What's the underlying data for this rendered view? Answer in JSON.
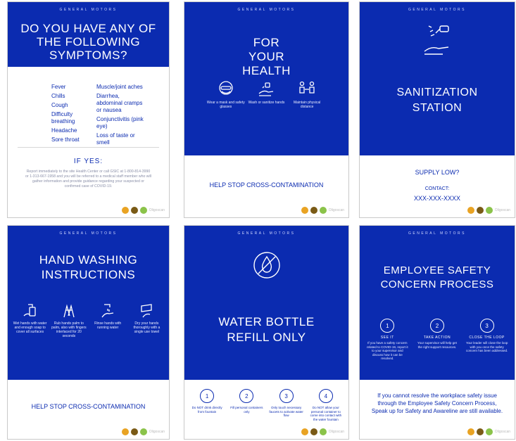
{
  "theme": {
    "blue": "#0b2bb0"
  },
  "brand": "GENERAL MOTORS",
  "footer_logo_word": "Oligoscan",
  "poster1": {
    "title": "DO YOU HAVE ANY OF THE FOLLOWING SYMPTOMS?",
    "left_symptoms": [
      "Fever",
      "Chills",
      "Cough",
      "Difficulty breathing",
      "Headache",
      "Sore throat"
    ],
    "right_symptoms": [
      "Muscle/joint aches",
      "Diarrhea, abdominal cramps or nausea",
      "Conjunctivitis (pink eye)",
      "Loss of taste or smell"
    ],
    "if_yes": "IF YES:",
    "body": "Report immediately to the site Health Center or call GSIC at 1-800-814-3990 or 1-313-667-1958 and you will be referred to a medical staff member who will gather information and provide guidance regarding your suspected or confirmed case of COVID-19."
  },
  "poster2": {
    "title": "FOR YOUR HEALTH",
    "icons": [
      {
        "icon": "mask-goggles-icon",
        "caption": "Wear a mask and safety glasses"
      },
      {
        "icon": "hand-wash-icon",
        "caption": "Wash or sanitize hands"
      },
      {
        "icon": "distance-icon",
        "caption": "Maintain physical distance"
      }
    ],
    "footer": "HELP STOP CROSS-CONTAMINATION"
  },
  "poster3": {
    "title": "SANITIZATION STATION",
    "icon": "spray-hand-icon",
    "supply": "SUPPLY LOW?",
    "contact_label": "CONTACT:",
    "contact_number": "XXX-XXX-XXXX"
  },
  "poster4": {
    "title": "HAND WASHING INSTRUCTIONS",
    "steps": [
      {
        "icon": "soap-dispenser-icon",
        "caption": "Wet hands with water and enough soap to cover all surfaces"
      },
      {
        "icon": "rub-hands-icon",
        "caption": "Rub hands palm to palm, also with fingers interlaced for 20 seconds"
      },
      {
        "icon": "rinse-hands-icon",
        "caption": "Rinse hands with running water"
      },
      {
        "icon": "paper-towel-icon",
        "caption": "Dry your hands thoroughly with a single use towel"
      }
    ],
    "footer": "HELP STOP CROSS-CONTAMINATION"
  },
  "poster5": {
    "title": "WATER BOTTLE REFILL ONLY",
    "icon": "no-drop-icon",
    "steps": [
      {
        "num": "1",
        "caption": "Do NOT drink directly from fountain"
      },
      {
        "num": "2",
        "caption": "Fill personal containers only"
      },
      {
        "num": "3",
        "caption": "Only touch necessary faucets to activate water flow"
      },
      {
        "num": "4",
        "caption": "Do NOT allow your personal container to come into contact with the water fountain"
      }
    ]
  },
  "poster6": {
    "title": "EMPLOYEE SAFETY CONCERN PROCESS",
    "steps": [
      {
        "num": "1",
        "head": "SEE IT",
        "caption": "If you have a safety concern related to COVID-19, report it to your supervisor and discuss how it can be resolved."
      },
      {
        "num": "2",
        "head": "TAKE ACTION",
        "caption": "Your supervisor will help get the right support resources."
      },
      {
        "num": "3",
        "head": "CLOSE THE LOOP",
        "caption": "Your leader will close the loop with you once the safety concern has been addressed."
      }
    ],
    "body": "If you cannot resolve the workplace safety issue through the Employee Safety Concern Process, Speak up for Safety and Awareline are still available."
  }
}
